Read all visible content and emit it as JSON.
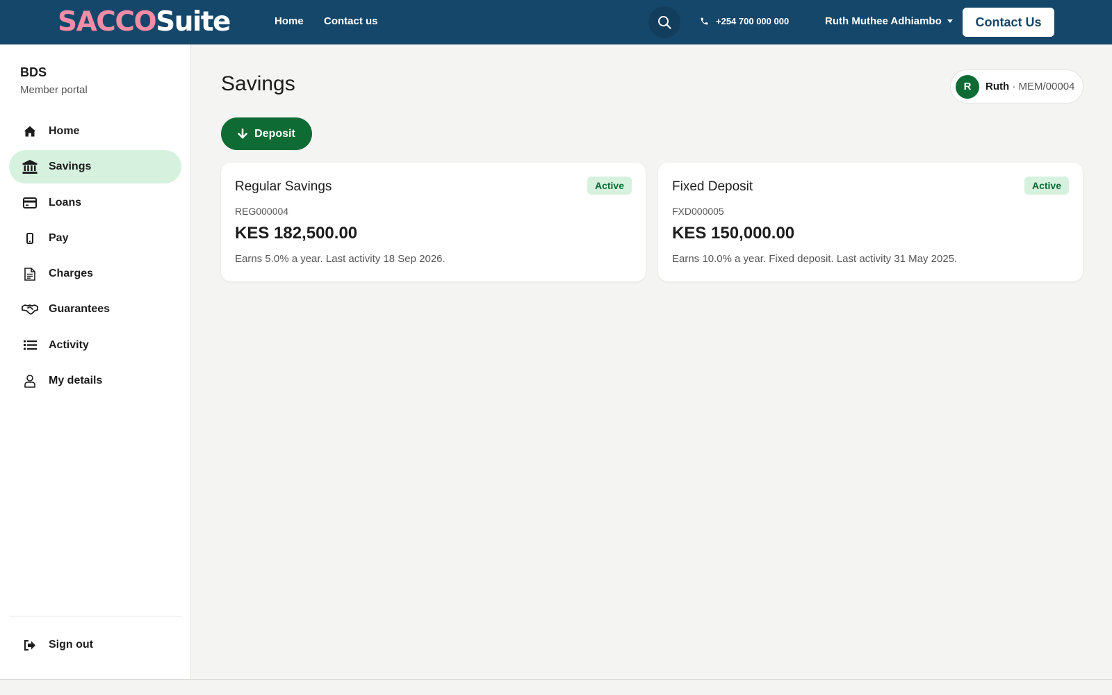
{
  "brand": {
    "part1": "SACCO",
    "part2": "Suite"
  },
  "topnav": {
    "links": [
      "Home",
      "Contact us"
    ],
    "phone": "+254 700 000 000",
    "user_name": "Ruth Muthee Adhiambo",
    "contact_button": "Contact Us"
  },
  "sidebar": {
    "org_name": "BDS",
    "org_subtitle": "Member portal",
    "items": [
      {
        "label": "Home",
        "icon": "home-icon"
      },
      {
        "label": "Savings",
        "icon": "bank-icon",
        "active": true
      },
      {
        "label": "Loans",
        "icon": "credit-card-icon"
      },
      {
        "label": "Pay",
        "icon": "mobile-phone-icon"
      },
      {
        "label": "Charges",
        "icon": "document-icon"
      },
      {
        "label": "Guarantees",
        "icon": "handshake-icon"
      },
      {
        "label": "Activity",
        "icon": "list-icon"
      },
      {
        "label": "My details",
        "icon": "user-icon"
      }
    ],
    "sign_out": "Sign out"
  },
  "main": {
    "title": "Savings",
    "member_chip": {
      "initial": "R",
      "name": "Ruth",
      "separator": " · ",
      "member_no": "MEM/00004"
    },
    "deposit_button": "Deposit",
    "accounts": [
      {
        "title": "Regular Savings",
        "status": "Active",
        "code": "REG000004",
        "amount": "KES 182,500.00",
        "description": "Earns 5.0% a year. Last activity 18 Sep 2026."
      },
      {
        "title": "Fixed Deposit",
        "status": "Active",
        "code": "FXD000005",
        "amount": "KES 150,000.00",
        "description": "Earns 10.0% a year. Fixed deposit. Last activity 31 May 2025."
      }
    ]
  },
  "colors": {
    "header_bg": "#14476a",
    "brand_pink": "#f48ca6",
    "primary_green": "#0e6b34",
    "active_bg": "#d6f2df"
  }
}
